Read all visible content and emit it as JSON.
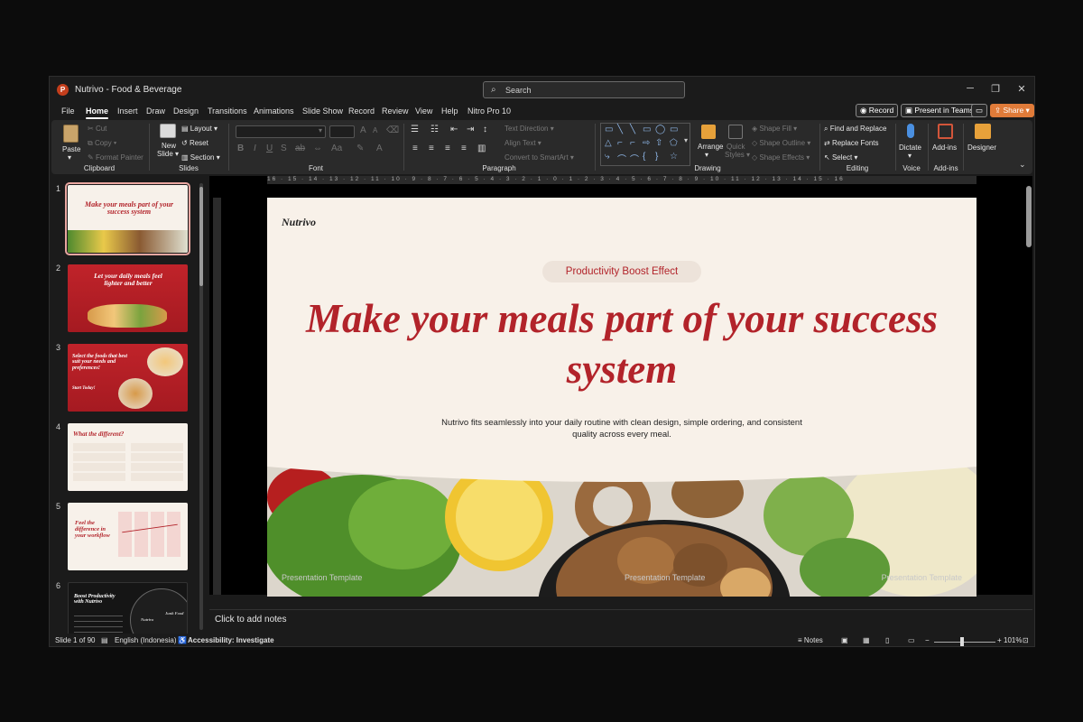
{
  "window": {
    "title": "Nutrivo - Food & Beverage",
    "search_placeholder": "Search",
    "app_letter": "P"
  },
  "tabs": [
    "File",
    "Home",
    "Insert",
    "Draw",
    "Design",
    "Transitions",
    "Animations",
    "Slide Show",
    "Record",
    "Review",
    "View",
    "Help",
    "Nitro Pro 10"
  ],
  "active_tab": "Home",
  "top_buttons": {
    "record": "Record",
    "present": "Present in Teams",
    "share": "Share"
  },
  "ribbon": {
    "clipboard": {
      "label": "Clipboard",
      "paste": "Paste",
      "cut": "Cut",
      "copy": "Copy",
      "format_painter": "Format Painter"
    },
    "slides": {
      "label": "Slides",
      "new_slide": "New",
      "new_slide2": "Slide",
      "layout": "Layout",
      "reset": "Reset",
      "section": "Section"
    },
    "font": {
      "label": "Font"
    },
    "paragraph": {
      "label": "Paragraph",
      "text_direction": "Text Direction",
      "align_text": "Align Text",
      "convert": "Convert to SmartArt"
    },
    "drawing": {
      "label": "Drawing",
      "arrange": "Arrange",
      "quick": "Quick",
      "styles": "Styles",
      "shape_fill": "Shape Fill",
      "shape_outline": "Shape Outline",
      "shape_effects": "Shape Effects"
    },
    "editing": {
      "label": "Editing",
      "find_replace": "Find and Replace",
      "replace_fonts": "Replace Fonts",
      "select": "Select"
    },
    "voice": {
      "label": "Voice",
      "dictate": "Dictate"
    },
    "addins": {
      "label": "Add-ins",
      "button": "Add-ins"
    },
    "designer": {
      "button": "Designer"
    }
  },
  "thumbnails": [
    {
      "num": "1",
      "title": "Make your meals part of your success system"
    },
    {
      "num": "2",
      "title": "Let your daily meals feel lighter and better"
    },
    {
      "num": "3",
      "title": "Select the foods that best suit your needs and preferences!",
      "extra": "Start Today!"
    },
    {
      "num": "4",
      "title": "What the different?"
    },
    {
      "num": "5",
      "title": "Feel the difference in your workflow"
    },
    {
      "num": "6",
      "title": "Boost Productivity with Nutrivo",
      "pie_a": "Nutrivo",
      "pie_b": "Junk Food"
    }
  ],
  "ruler_text": "16 · 15 · 14 · 13 · 12 · 11 · 10 · 9 · 8 · 7 · 6 · 5 · 4 · 3 · 2 · 1 · 0 · 1 · 2 · 3 · 4 · 5 · 6 · 7 · 8 · 9 · 10 · 11 · 12 · 13 · 14 · 15 · 16",
  "slide": {
    "brand": "Nutrivo",
    "pill": "Productivity Boost Effect",
    "headline": "Make your meals part of your success system",
    "subtitle": "Nutrivo fits seamlessly into your daily routine with clean design, simple ordering, and consistent quality across every meal.",
    "footer_left": "Presentation Template",
    "footer_mid": "Presentation Template",
    "footer_right": "Presentation Template"
  },
  "notes_placeholder": "Click to add notes",
  "status": {
    "slide": "Slide 1 of 90",
    "language": "English (Indonesia)",
    "accessibility": "Accessibility: Investigate",
    "notes": "Notes",
    "zoom": "101%"
  }
}
